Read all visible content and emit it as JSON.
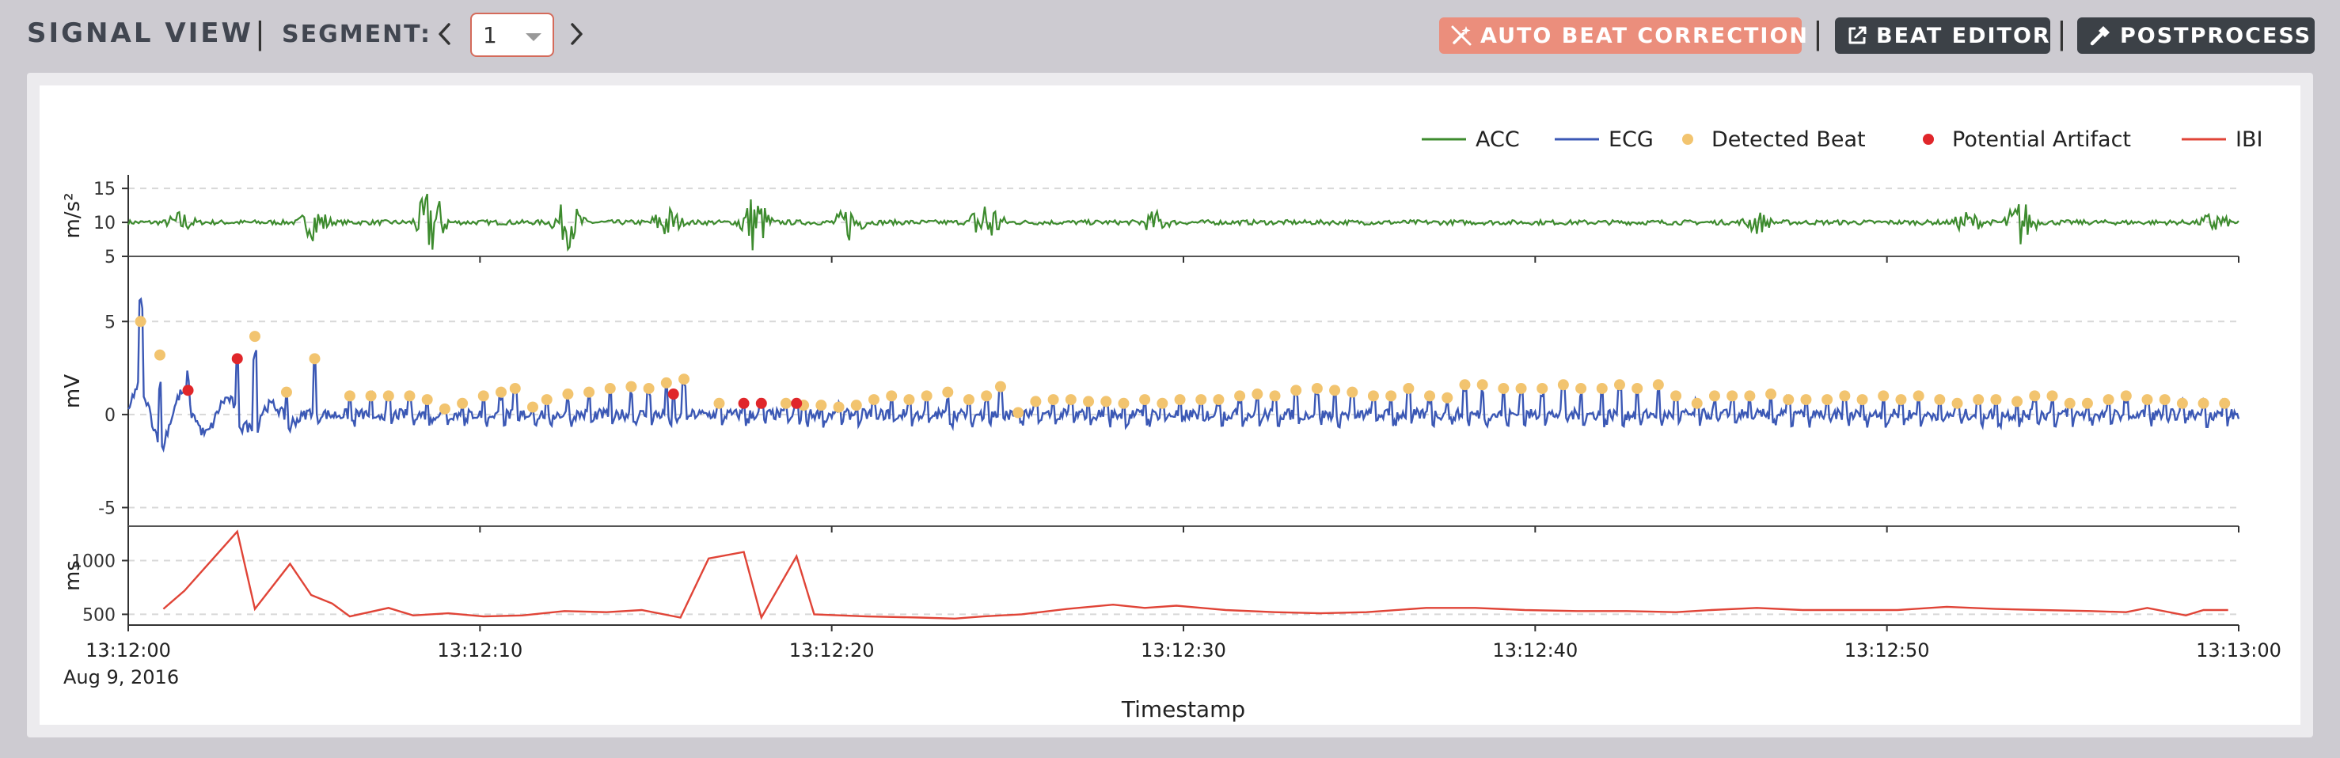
{
  "header": {
    "title": "SIGNAL VIEW",
    "separator": "|",
    "segment_label": "SEGMENT:",
    "segment_value": "1"
  },
  "toolbar": {
    "auto_beat_label": "AUTO BEAT CORRECTION",
    "beat_editor_label": "BEAT EDITOR",
    "postprocess_label": "POSTPROCESS"
  },
  "colors": {
    "acc": "#3d8b2e",
    "ecg": "#3b58b5",
    "beat": "#f2c46f",
    "artifact": "#e0262a",
    "ibi": "#e04437",
    "auto_button": "#eb8e7c",
    "dark_button": "#3c4147"
  },
  "icons": {
    "prev": "chevron-left-icon",
    "next": "chevron-right-icon",
    "select": "caret-down-icon",
    "auto": "wand-off-icon",
    "editor": "external-link-icon",
    "post": "hammer-icon"
  },
  "chart_data": {
    "type": "line",
    "legend": [
      "ACC",
      "ECG",
      "Detected Beat",
      "Potential Artifact",
      "IBI"
    ],
    "legend_placement": "top-right",
    "xlabel": "Timestamp",
    "x_range_seconds": [
      0,
      60
    ],
    "x_ticks": [
      "13:12:00",
      "13:12:10",
      "13:12:20",
      "13:12:30",
      "13:12:40",
      "13:12:50",
      "13:13:00"
    ],
    "x_date_label": "Aug 9, 2016",
    "panels": [
      {
        "name": "ACC",
        "ylabel": "m/s²",
        "ylim": [
          5,
          17
        ],
        "ticks": [
          5,
          10,
          15
        ],
        "baseline": 10,
        "bursts": [
          [
            1.5,
            2
          ],
          [
            5.3,
            3
          ],
          [
            8.6,
            6
          ],
          [
            12.5,
            4
          ],
          [
            15.3,
            3
          ],
          [
            17.8,
            5
          ],
          [
            20.5,
            3
          ],
          [
            24.4,
            5
          ],
          [
            29.2,
            2
          ],
          [
            46.3,
            2
          ],
          [
            52.3,
            2
          ],
          [
            53.8,
            4
          ],
          [
            59.3,
            2
          ]
        ]
      },
      {
        "name": "ECG",
        "ylabel": "mV",
        "ylim": [
          -6,
          8.5
        ],
        "ticks": [
          -5,
          0,
          5
        ],
        "detected_beats": [
          [
            0.35,
            5.0
          ],
          [
            0.9,
            3.2
          ],
          [
            3.6,
            4.2
          ],
          [
            4.5,
            1.2
          ],
          [
            5.3,
            3.0
          ],
          [
            6.3,
            1.0
          ],
          [
            6.9,
            1.0
          ],
          [
            7.4,
            1.0
          ],
          [
            8.0,
            1.0
          ],
          [
            8.5,
            0.8
          ],
          [
            9.0,
            0.3
          ],
          [
            9.5,
            0.6
          ],
          [
            10.1,
            1.0
          ],
          [
            10.6,
            1.2
          ],
          [
            11.0,
            1.4
          ],
          [
            11.5,
            0.4
          ],
          [
            11.9,
            0.8
          ],
          [
            12.5,
            1.1
          ],
          [
            13.1,
            1.2
          ],
          [
            13.7,
            1.4
          ],
          [
            14.3,
            1.5
          ],
          [
            14.8,
            1.4
          ],
          [
            15.3,
            1.7
          ],
          [
            15.8,
            1.9
          ],
          [
            16.8,
            0.6
          ],
          [
            18.7,
            0.6
          ],
          [
            19.2,
            0.5
          ],
          [
            19.7,
            0.5
          ],
          [
            20.2,
            0.4
          ],
          [
            20.7,
            0.5
          ],
          [
            21.2,
            0.8
          ],
          [
            21.7,
            1.0
          ],
          [
            22.2,
            0.8
          ],
          [
            22.7,
            1.0
          ],
          [
            23.3,
            1.2
          ],
          [
            23.9,
            0.8
          ],
          [
            24.4,
            1.0
          ],
          [
            24.8,
            1.5
          ],
          [
            25.3,
            0.1
          ],
          [
            25.8,
            0.7
          ],
          [
            26.3,
            0.8
          ],
          [
            26.8,
            0.8
          ],
          [
            27.3,
            0.7
          ],
          [
            27.8,
            0.7
          ],
          [
            28.3,
            0.6
          ],
          [
            28.9,
            0.8
          ],
          [
            29.4,
            0.6
          ],
          [
            29.9,
            0.8
          ],
          [
            30.5,
            0.8
          ],
          [
            31.0,
            0.8
          ],
          [
            31.6,
            1.0
          ],
          [
            32.1,
            1.1
          ],
          [
            32.6,
            1.0
          ],
          [
            33.2,
            1.3
          ],
          [
            33.8,
            1.4
          ],
          [
            34.3,
            1.3
          ],
          [
            34.8,
            1.2
          ],
          [
            35.4,
            1.0
          ],
          [
            35.9,
            1.0
          ],
          [
            36.4,
            1.4
          ],
          [
            37.0,
            1.0
          ],
          [
            37.5,
            0.9
          ],
          [
            38.0,
            1.6
          ],
          [
            38.5,
            1.6
          ],
          [
            39.1,
            1.4
          ],
          [
            39.6,
            1.4
          ],
          [
            40.2,
            1.4
          ],
          [
            40.8,
            1.6
          ],
          [
            41.3,
            1.4
          ],
          [
            41.9,
            1.4
          ],
          [
            42.4,
            1.6
          ],
          [
            42.9,
            1.4
          ],
          [
            43.5,
            1.6
          ],
          [
            44.0,
            1.0
          ],
          [
            44.6,
            0.6
          ],
          [
            45.1,
            1.0
          ],
          [
            45.6,
            1.0
          ],
          [
            46.1,
            1.0
          ],
          [
            46.7,
            1.1
          ],
          [
            47.2,
            0.8
          ],
          [
            47.7,
            0.8
          ],
          [
            48.3,
            0.8
          ],
          [
            48.8,
            1.0
          ],
          [
            49.3,
            0.8
          ],
          [
            49.9,
            1.0
          ],
          [
            50.4,
            0.8
          ],
          [
            50.9,
            1.0
          ],
          [
            51.5,
            0.8
          ],
          [
            52.0,
            0.6
          ],
          [
            52.6,
            0.8
          ],
          [
            53.1,
            0.8
          ],
          [
            53.7,
            0.7
          ],
          [
            54.2,
            1.0
          ],
          [
            54.7,
            1.0
          ],
          [
            55.2,
            0.6
          ],
          [
            55.7,
            0.6
          ],
          [
            56.3,
            0.8
          ],
          [
            56.8,
            1.0
          ],
          [
            57.4,
            0.8
          ],
          [
            57.9,
            0.8
          ],
          [
            58.4,
            0.6
          ],
          [
            59.0,
            0.6
          ],
          [
            59.6,
            0.6
          ]
        ],
        "potential_artifacts": [
          [
            1.7,
            1.3
          ],
          [
            3.1,
            3.0
          ],
          [
            15.5,
            1.1
          ],
          [
            17.5,
            0.6
          ],
          [
            18.0,
            0.6
          ],
          [
            19.0,
            0.6
          ]
        ]
      },
      {
        "name": "IBI",
        "ylabel": "ms",
        "ylim": [
          400,
          1320
        ],
        "ticks": [
          500,
          1000
        ],
        "points": [
          [
            1.0,
            550
          ],
          [
            1.6,
            720
          ],
          [
            3.1,
            1270
          ],
          [
            3.6,
            550
          ],
          [
            4.6,
            970
          ],
          [
            5.2,
            680
          ],
          [
            5.8,
            600
          ],
          [
            6.3,
            480
          ],
          [
            7.4,
            560
          ],
          [
            8.1,
            490
          ],
          [
            9.1,
            510
          ],
          [
            10.1,
            480
          ],
          [
            11.2,
            490
          ],
          [
            12.4,
            530
          ],
          [
            13.6,
            520
          ],
          [
            14.6,
            540
          ],
          [
            15.7,
            470
          ],
          [
            16.5,
            1020
          ],
          [
            17.5,
            1080
          ],
          [
            18.0,
            470
          ],
          [
            19.0,
            1040
          ],
          [
            19.5,
            500
          ],
          [
            21.0,
            480
          ],
          [
            22.5,
            470
          ],
          [
            23.5,
            460
          ],
          [
            24.3,
            480
          ],
          [
            25.4,
            500
          ],
          [
            26.7,
            550
          ],
          [
            28.0,
            590
          ],
          [
            28.9,
            560
          ],
          [
            29.8,
            580
          ],
          [
            31.2,
            540
          ],
          [
            32.6,
            520
          ],
          [
            33.9,
            510
          ],
          [
            35.2,
            520
          ],
          [
            36.9,
            560
          ],
          [
            38.3,
            560
          ],
          [
            39.7,
            540
          ],
          [
            41.2,
            530
          ],
          [
            42.6,
            530
          ],
          [
            44.0,
            520
          ],
          [
            45.0,
            540
          ],
          [
            46.3,
            560
          ],
          [
            47.6,
            540
          ],
          [
            48.9,
            540
          ],
          [
            50.3,
            540
          ],
          [
            51.7,
            570
          ],
          [
            53.1,
            550
          ],
          [
            54.4,
            540
          ],
          [
            55.8,
            530
          ],
          [
            56.8,
            520
          ],
          [
            57.4,
            560
          ],
          [
            58.5,
            490
          ],
          [
            59.0,
            540
          ],
          [
            59.7,
            540
          ]
        ]
      }
    ]
  }
}
